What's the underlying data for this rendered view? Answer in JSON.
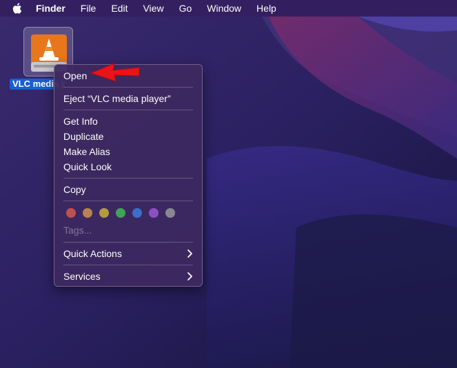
{
  "menubar": {
    "apple_icon": "apple-logo-icon",
    "items": [
      "Finder",
      "File",
      "Edit",
      "View",
      "Go",
      "Window",
      "Help"
    ]
  },
  "desktop": {
    "drive_label": "VLC media player",
    "drive_icon": "vlc-drive-icon"
  },
  "context_menu": {
    "items": [
      "Open",
      "Eject “VLC media player”",
      "Get Info",
      "Duplicate",
      "Make Alias",
      "Quick Look",
      "Copy",
      "Quick Actions",
      "Services"
    ],
    "tags_placeholder": "Tags...",
    "tag_colors": [
      "#c0504d",
      "#b8834f",
      "#b59a3e",
      "#3fa35a",
      "#3a6fc9",
      "#8e4fc2",
      "#8a8690"
    ],
    "submenu_icon": "chevron-right-icon"
  },
  "annotation": {
    "arrow_color": "#e8141a",
    "arrow_icon": "red-arrow-icon"
  }
}
